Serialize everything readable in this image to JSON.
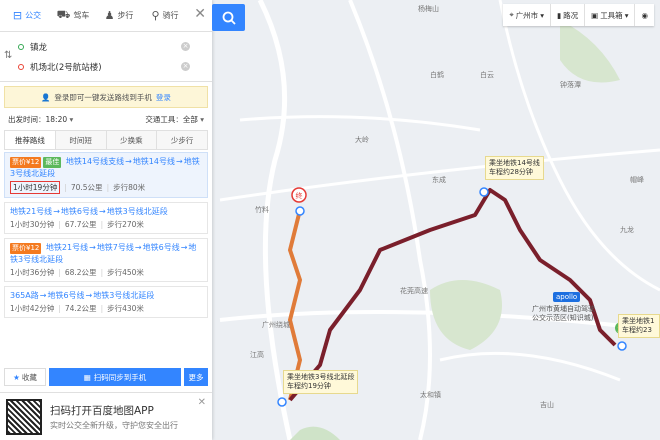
{
  "modes": [
    {
      "label": "公交",
      "icon": "bus-icon"
    },
    {
      "label": "驾车",
      "icon": "car-icon"
    },
    {
      "label": "步行",
      "icon": "walk-icon"
    },
    {
      "label": "骑行",
      "icon": "bike-icon"
    }
  ],
  "route_inputs": {
    "start": "镇龙",
    "end": "机场北(2号航站楼)"
  },
  "notice": {
    "text": "登录即可一键发送路线到手机",
    "login_label": "登录"
  },
  "settings": {
    "depart_label": "出发时间",
    "depart_value": "18:20",
    "transport_label": "交通工具",
    "transport_value": "全部"
  },
  "sort_tabs": [
    "推荐路线",
    "时间短",
    "少换乘",
    "少步行"
  ],
  "routes": [
    {
      "price": "票价¥12",
      "badge": "最佳",
      "segments": [
        "地铁14号线支线",
        "地铁14号线",
        "地铁3号线北延段"
      ],
      "duration": "1小时19分钟",
      "distance": "70.5公里",
      "walk": "步行80米"
    },
    {
      "price": "",
      "badge": "",
      "segments": [
        "地铁21号线",
        "地铁6号线",
        "地铁3号线北延段"
      ],
      "duration": "1小时30分钟",
      "distance": "67.7公里",
      "walk": "步行270米"
    },
    {
      "price": "票价¥12",
      "badge": "",
      "segments": [
        "地铁21号线",
        "地铁7号线",
        "地铁6号线",
        "地铁3号线北延段"
      ],
      "duration": "1小时36分钟",
      "distance": "68.2公里",
      "walk": "步行450米"
    },
    {
      "price": "",
      "badge": "",
      "segments": [
        "365A路",
        "地铁6号线",
        "地铁3号线北延段"
      ],
      "duration": "1小时42分钟",
      "distance": "74.2公里",
      "walk": "步行430米"
    }
  ],
  "actions": {
    "favorite": "收藏",
    "send": "扫码同步到手机",
    "more": "更多"
  },
  "promo": {
    "title": "扫码打开百度地图APP",
    "subtitle": "实时公交全新升级，守护您安全出行"
  },
  "toolbar": {
    "city": "广州市",
    "traffic": "路况",
    "tools": "工具箱"
  },
  "map_labels": {
    "callout_14": "乘坐地铁14号线\n车程约28分钟",
    "callout_3": "乘坐地铁3号线北延段\n车程约19分钟",
    "callout_right": "乘坐地铁1\n车程约23",
    "apollo": "apollo",
    "park": "广州市黄埔自动驾驶\n公交示范区(知识城)",
    "places": [
      "杨梅山",
      "白鹤",
      "大岭",
      "竹料",
      "东成",
      "花莞高速",
      "江高",
      "广州绕城",
      "白云",
      "钟落潭",
      "九龙",
      "帽峰",
      "太和镇",
      "吉山"
    ]
  },
  "colors": {
    "accent": "#3385ff",
    "route_main": "#7a1f2b",
    "route_orange": "#e07b39",
    "price_tag": "#f47a1f"
  }
}
